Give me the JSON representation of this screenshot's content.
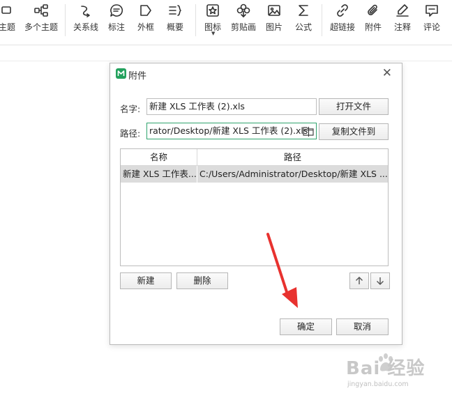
{
  "toolbar": {
    "items": [
      {
        "label": "主题",
        "icon": "topic-icon"
      },
      {
        "label": "多个主题",
        "icon": "multi-topic-icon"
      },
      {
        "label": "关系线",
        "icon": "relation-line-icon"
      },
      {
        "label": "标注",
        "icon": "callout-icon"
      },
      {
        "label": "外框",
        "icon": "boundary-icon"
      },
      {
        "label": "概要",
        "icon": "summary-icon"
      },
      {
        "label": "图标",
        "icon": "mark-icon"
      },
      {
        "label": "剪贴画",
        "icon": "clipart-icon"
      },
      {
        "label": "图片",
        "icon": "image-icon"
      },
      {
        "label": "公式",
        "icon": "formula-icon"
      },
      {
        "label": "超链接",
        "icon": "hyperlink-icon"
      },
      {
        "label": "附件",
        "icon": "attachment-icon"
      },
      {
        "label": "注释",
        "icon": "note-icon"
      },
      {
        "label": "评论",
        "icon": "comment-icon"
      }
    ]
  },
  "dialog": {
    "title": "附件",
    "name_label": "名字:",
    "name_value": "新建 XLS 工作表 (2).xls",
    "path_label": "路径:",
    "path_value": "rator/Desktop/新建 XLS 工作表 (2).xls",
    "open_file_button": "打开文件",
    "copy_file_button": "复制文件到",
    "table": {
      "headers": [
        "名称",
        "路径"
      ],
      "rows": [
        [
          "新建 XLS 工作表...",
          "C:/Users/Administrator/Desktop/新建 XLS ..."
        ]
      ]
    },
    "new_button": "新建",
    "delete_button": "删除",
    "ok_button": "确定",
    "cancel_button": "取消"
  },
  "watermark": {
    "main": "Bai 经验",
    "sub": "jingyan.baidu.com"
  },
  "colors": {
    "accent": "#23a15d",
    "arrow": "#e8322f",
    "selected_row": "#dcdcdc"
  }
}
